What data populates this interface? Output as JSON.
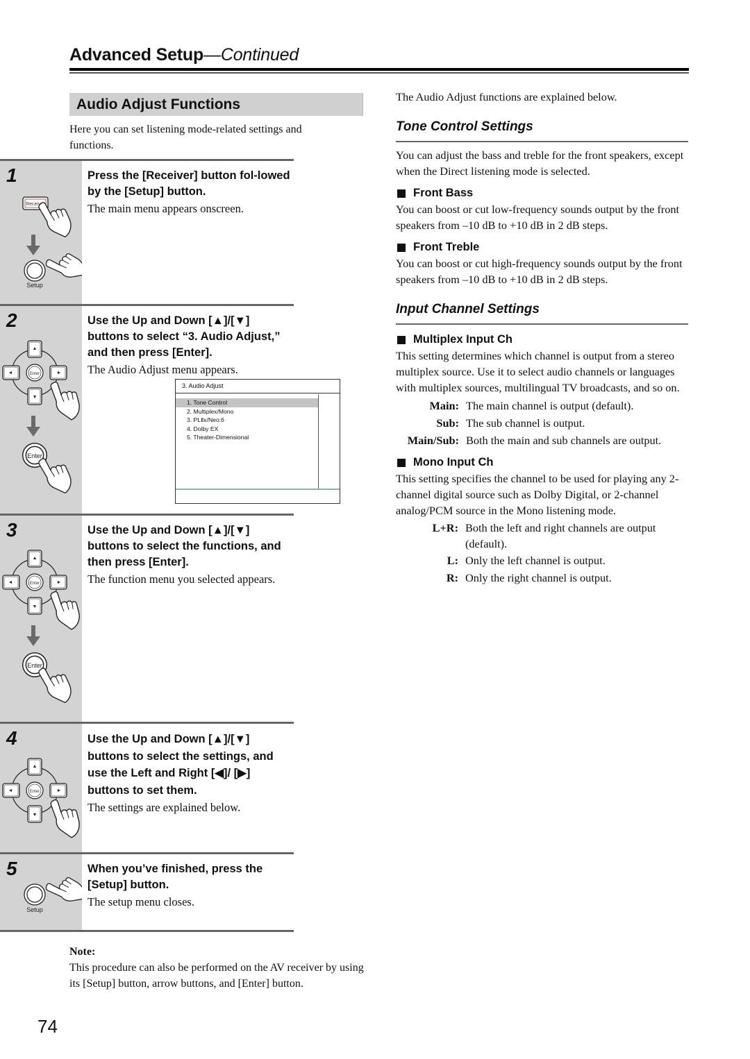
{
  "header": {
    "title": "Advanced Setup",
    "title_suffix": "—Continued"
  },
  "left": {
    "section_title": "Audio Adjust Functions",
    "intro": "Here you can set listening mode-related settings and functions.",
    "steps": [
      {
        "number": "1",
        "instruction": "Press the [Receiver] button fol-lowed by the [Setup] button.",
        "result": "The main menu appears onscreen.",
        "icons": [
          "receiver-button",
          "hand-press",
          "arrow-down",
          "setup-button"
        ],
        "receiver_label": "Receiver",
        "setup_label": "Setup"
      },
      {
        "number": "2",
        "instruction": "Use the Up and Down [▲]/[▼] buttons to select “3. Audio Adjust,” and then press [Enter].",
        "result": "The Audio Adjust menu appears.",
        "icons": [
          "arrow-pad",
          "hand-press",
          "arrow-down",
          "enter-button"
        ],
        "enter_label": "Enter",
        "pad_center_label": "Enter"
      },
      {
        "number": "3",
        "instruction": "Use the Up and Down [▲]/[▼] buttons to select the functions, and then press [Enter].",
        "result": "The function menu you selected appears.",
        "icons": [
          "arrow-pad",
          "hand-press",
          "arrow-down",
          "enter-button"
        ],
        "enter_label": "Enter",
        "pad_center_label": "Enter"
      },
      {
        "number": "4",
        "instruction": "Use the Up and Down [▲]/[▼] buttons to select the settings, and use the Left and Right [◀]/ [▶] buttons to set them.",
        "result": "The settings are explained below.",
        "icons": [
          "arrow-pad",
          "hand-press"
        ],
        "pad_center_label": "Enter"
      },
      {
        "number": "5",
        "instruction": "When you’ve finished, press the [Setup] button.",
        "result": "The setup menu closes.",
        "icons": [
          "setup-button",
          "hand-press"
        ],
        "setup_label": "Setup"
      }
    ],
    "menu_screen": {
      "title": "3.  Audio Adjust",
      "items": [
        {
          "label": "1.  Tone Control",
          "selected": true
        },
        {
          "label": "2.  Multiplex/Mono",
          "selected": false
        },
        {
          "label": "3.  PLⅡx/Neo:6",
          "selected": false
        },
        {
          "label": "4.  Dolby EX",
          "selected": false
        },
        {
          "label": "5.  Theater-Dimensional",
          "selected": false
        }
      ]
    },
    "note": {
      "label": "Note:",
      "text": "This procedure can also be performed on the AV receiver by using its [Setup] button, arrow buttons, and [Enter] button."
    },
    "page_number": "74"
  },
  "right": {
    "lead": "The Audio Adjust functions are explained below.",
    "tone": {
      "heading": "Tone Control Settings",
      "intro": "You can adjust the bass and treble for the front speakers, except when the Direct listening mode is selected.",
      "front_bass": {
        "title": "Front Bass",
        "text": "You can boost or cut low-frequency sounds output by the front speakers from –10 dB to +10 dB in 2 dB steps."
      },
      "front_treble": {
        "title": "Front Treble",
        "text": "You can boost or cut high-frequency sounds output by the front speakers from –10 dB to +10 dB in 2 dB steps."
      }
    },
    "input": {
      "heading": "Input Channel Settings",
      "multiplex": {
        "title": "Multiplex Input Ch",
        "text": "This setting determines which channel is output from a stereo multiplex source. Use it to select audio channels or languages with multiplex sources, multilingual TV broadcasts, and so on.",
        "options": [
          {
            "key": "Main:",
            "desc": "The main channel is output (default)."
          },
          {
            "key": "Sub:",
            "desc": "The sub channel is output."
          },
          {
            "key": "Main/Sub:",
            "desc": "Both the main and sub channels are output."
          }
        ]
      },
      "mono": {
        "title": "Mono Input Ch",
        "text": "This setting specifies the channel to be used for playing any 2-channel digital source such as Dolby Digital, or 2-channel analog/PCM source in the Mono listening mode.",
        "options": [
          {
            "key": "L+R:",
            "desc": "Both the left and right channels are output (default)."
          },
          {
            "key": "L:",
            "desc": "Only the left channel is output."
          },
          {
            "key": "R:",
            "desc": "Only the right channel is output."
          }
        ]
      }
    }
  }
}
